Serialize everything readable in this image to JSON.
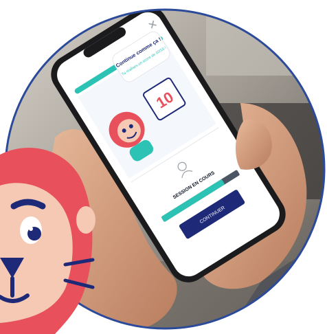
{
  "scene": {
    "background_color": "#ffffff",
    "circle_border_color": "#2b4a9a",
    "mascot_main_color": "#e8505b",
    "mascot_face_color": "#f6c9b4",
    "accent_teal": "#2cc3b5",
    "button_navy": "#1e2a78"
  },
  "phone_screen": {
    "close_icon": "close-icon",
    "speech_bubble": {
      "title": "Continue comme ça !",
      "subtitle": "Tu réalises un score de 10/10 !"
    },
    "score_card_value": "10",
    "session_icon": "user-badge-icon",
    "session_label": "SESSION EN COURS",
    "progress": 0.8,
    "continue_button_label": "CONTINUER"
  }
}
